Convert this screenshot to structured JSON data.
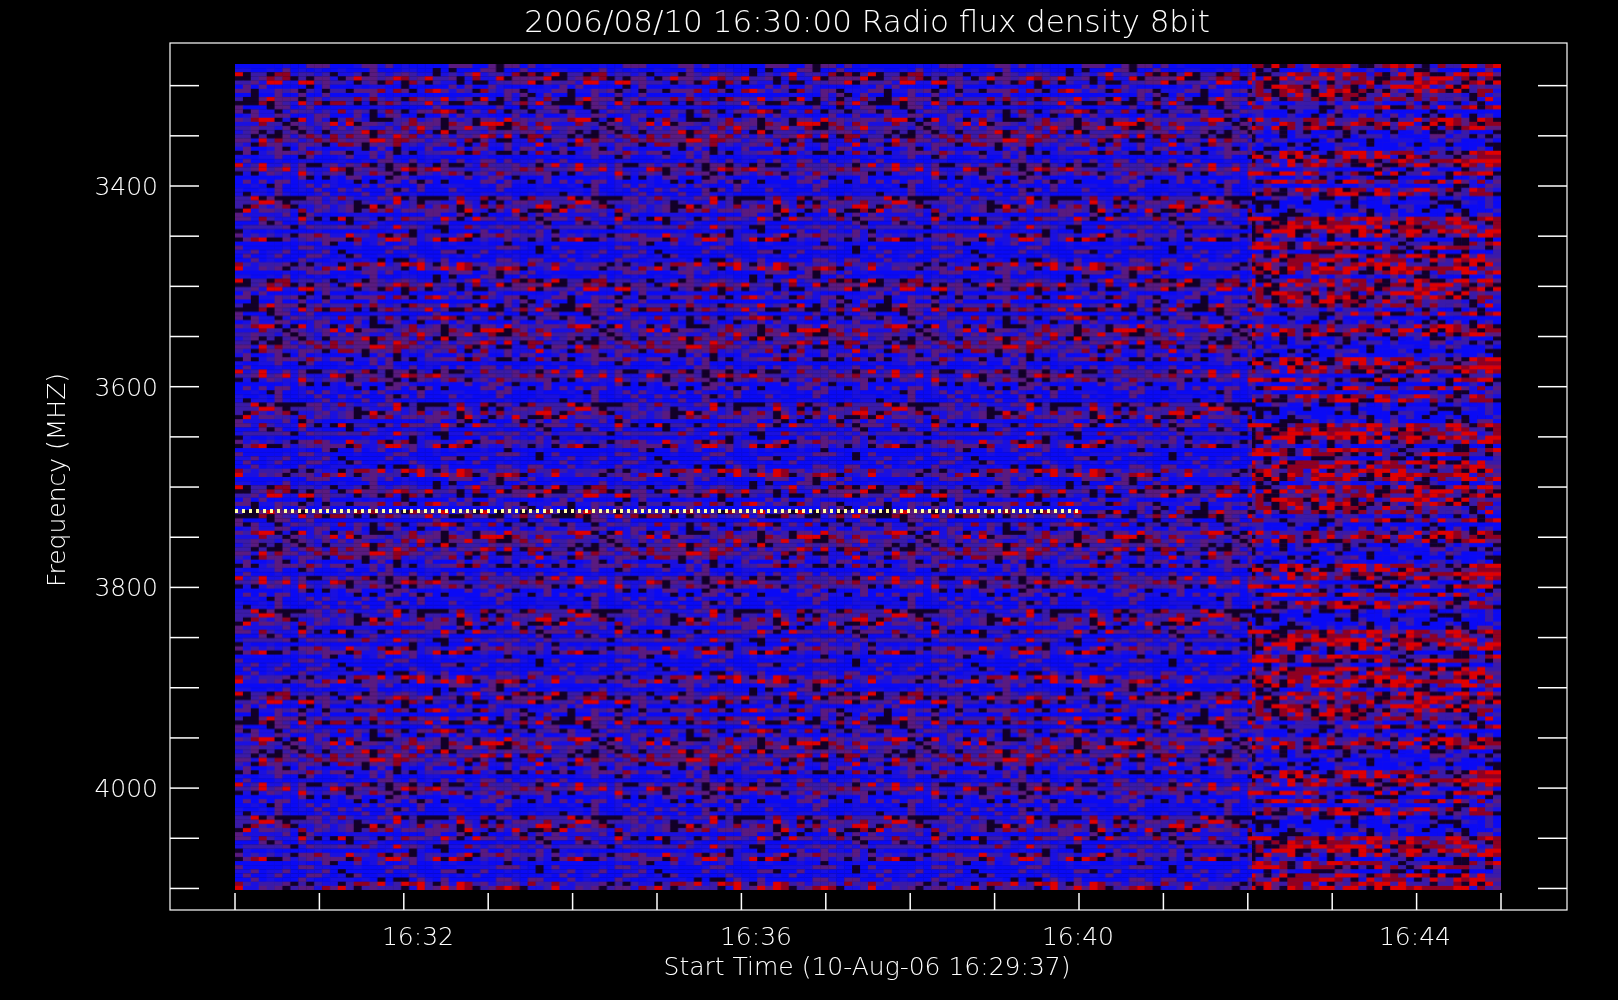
{
  "plot": {
    "title": "2006/08/10 16:30:00 Radio flux density 8bit",
    "ylabel": "Frequency (MHZ)",
    "xlabel": "Start Time (10-Aug-06 16:29:37)",
    "y_tick_labels": [
      "3400",
      "3600",
      "3800",
      "4000"
    ],
    "x_tick_labels": [
      "16:32",
      "16:36",
      "16:40",
      "16:44"
    ]
  }
}
